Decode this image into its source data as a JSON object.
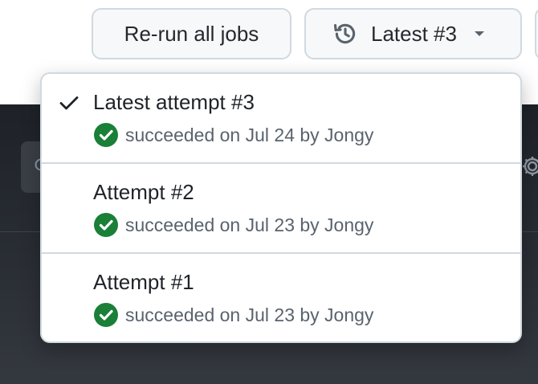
{
  "toolbar": {
    "rerun_label": "Re-run all jobs",
    "attempt_selector_label": "Latest #3"
  },
  "attempts_menu": {
    "items": [
      {
        "title": "Latest attempt #3",
        "status": "succeeded on Jul 24 by Jongy",
        "selected": true
      },
      {
        "title": "Attempt #2",
        "status": "succeeded on Jul 23 by Jongy",
        "selected": false
      },
      {
        "title": "Attempt #1",
        "status": "succeeded on Jul 23 by Jongy",
        "selected": false
      }
    ]
  },
  "icons": {
    "selector": "history-icon",
    "caret": "caret-down-icon",
    "selected": "check-icon",
    "status": "check-circle-fill-icon"
  },
  "colors": {
    "success": "#1a7f37",
    "border": "#d1d9e0",
    "button_bg": "#f6f8fa",
    "muted_text": "#59636e",
    "background_dark": "#1e2228"
  }
}
